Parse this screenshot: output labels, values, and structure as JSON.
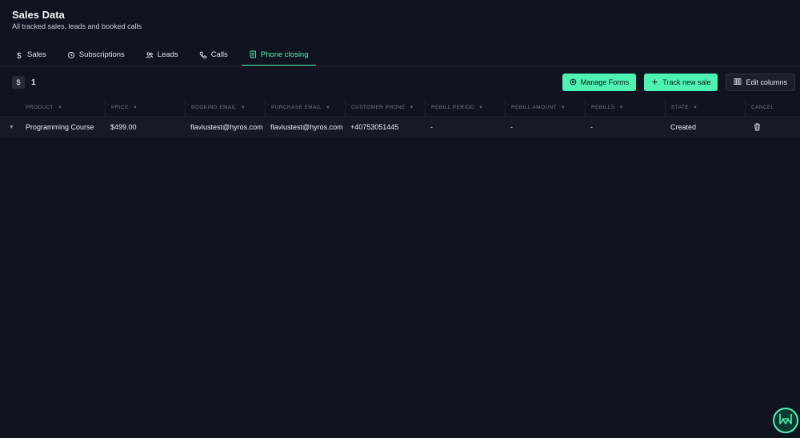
{
  "header": {
    "title": "Sales Data",
    "subtitle": "All tracked sales, leads and booked calls"
  },
  "tabs": [
    {
      "label": "Sales",
      "icon": "dollar-icon"
    },
    {
      "label": "Subscriptions",
      "icon": "refresh-icon"
    },
    {
      "label": "Leads",
      "icon": "users-icon"
    },
    {
      "label": "Calls",
      "icon": "phone-icon"
    },
    {
      "label": "Phone closing",
      "icon": "document-icon",
      "active": true
    }
  ],
  "toolbar": {
    "currency_symbol": "$",
    "count": "1",
    "manage_forms_label": "Manage Forms",
    "track_sale_label": "Track new sale",
    "edit_columns_label": "Edit columns"
  },
  "table": {
    "columns": [
      "Product",
      "Price",
      "Booking email",
      "Purchase email",
      "Customer phone",
      "Rebill period",
      "Rebill amount",
      "Rebills",
      "State",
      "Cancel"
    ],
    "rows": [
      {
        "product": "Programming Course",
        "price": "$499.00",
        "booking_email": "flaviustest@hyros.com",
        "purchase_email": "flaviustest@hyros.com",
        "customer_phone": "+40753051445",
        "rebill_period": "-",
        "rebill_amount": "-",
        "rebills": "-",
        "state": "Created"
      }
    ]
  },
  "colors": {
    "background": "#101421",
    "accent": "#4ef2b3",
    "row": "#151a26"
  }
}
